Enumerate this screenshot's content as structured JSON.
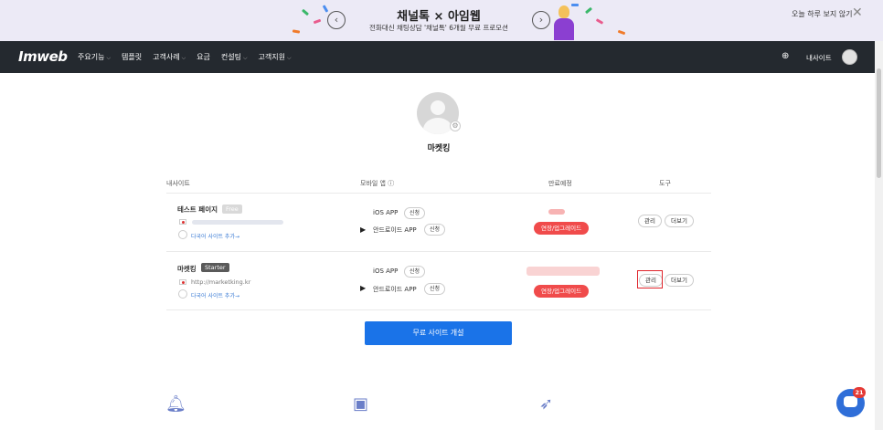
{
  "banner": {
    "title": "채널톡 × 아임웹",
    "subtitle": "전화대신 채팅상담 '채널톡' 6개월 무료 프로모션",
    "hide_today": "오늘 하루 보지 않기",
    "close_glyph": "✕",
    "prev_glyph": "‹",
    "next_glyph": "›"
  },
  "nav": {
    "logo": "Imweb",
    "menu": [
      "주요기능",
      "템플릿",
      "고객사례",
      "요금",
      "컨설팅",
      "고객지원"
    ],
    "caret": "⌵",
    "globe_glyph": "⊕",
    "my_site": "내사이트"
  },
  "profile": {
    "name": "마켓킹",
    "gear_glyph": "⚙"
  },
  "table": {
    "headers": {
      "my_site": "내사이트",
      "mobile_app": "모바일 앱",
      "info_glyph": "ⓘ",
      "expiry": "만료예정",
      "tools": "도구"
    },
    "rows": [
      {
        "name": "테스트 페이지",
        "plan": "Free",
        "plan_color": "#d9d9d9",
        "url": "",
        "multilang": "다국어 사이트 추가→",
        "ios": "iOS APP",
        "android": "안드로이드 APP",
        "apply": "신청",
        "renew": "연장/업그레이드",
        "manage": "관리",
        "more": "더보기"
      },
      {
        "name": "마켓킹",
        "plan": "Starter",
        "plan_color": "#5a5a5a",
        "url": "http://marketking.kr",
        "multilang": "다국어 사이트 추가→",
        "ios": "iOS APP",
        "android": "안드로이드 APP",
        "apply": "신청",
        "renew": "연장/업그레이드",
        "manage": "관리",
        "more": "더보기"
      }
    ]
  },
  "create_button": "무료 사이트 개설",
  "icons": {
    "apple": "",
    "play": "▶",
    "bell": "🔔︎",
    "image": "▣",
    "rocket": "➶"
  },
  "chat": {
    "badge": "21"
  },
  "colors": {
    "banner_bg": "#eceaf6",
    "nav_bg": "#24292f",
    "primary": "#1a73e8",
    "renew": "#f04b4b",
    "highlight": "#e0242b"
  }
}
